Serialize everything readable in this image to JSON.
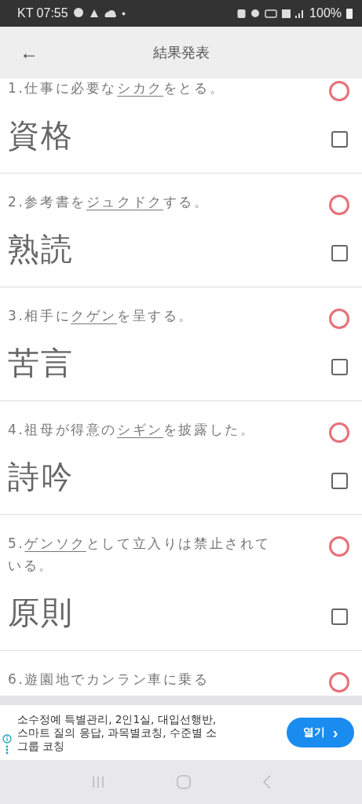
{
  "status_bar": {
    "carrier_time": "KT 07:55",
    "battery": "100%"
  },
  "header": {
    "back": "←",
    "title": "結果発表"
  },
  "items": [
    {
      "prefix": "1.仕事に必要な",
      "underlined": "シカク",
      "suffix": "をとる。",
      "answer": "資格",
      "correct": true,
      "checked": false
    },
    {
      "prefix": "2.参考書を",
      "underlined": "ジュクドク",
      "suffix": "する。",
      "answer": "熟読",
      "correct": true,
      "checked": false
    },
    {
      "prefix": "3.相手に",
      "underlined": "クゲン",
      "suffix": "を呈する。",
      "answer": "苦言",
      "correct": true,
      "checked": false
    },
    {
      "prefix": "4.祖母が得意の",
      "underlined": "シギン",
      "suffix": "を披露した。",
      "answer": "詩吟",
      "correct": true,
      "checked": false
    },
    {
      "prefix": "5.",
      "underlined": "ゲンソク",
      "suffix": "として立入りは禁止されている。",
      "answer": "原則",
      "correct": true,
      "checked": false
    },
    {
      "prefix": "6.遊園地でカンラン車に乗る",
      "correct": true
    }
  ],
  "ad": {
    "text": "소수정예 특별관리, 2인1실, 대입선행반, 스마트 질의 응답, 과목별코칭, 수준별 소그룹 코칭",
    "button": "열기",
    "button_caret": "›"
  }
}
